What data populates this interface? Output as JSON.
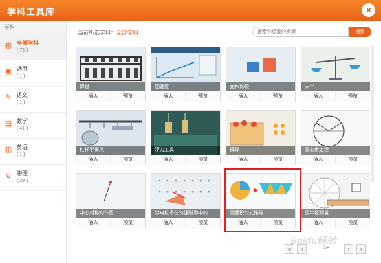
{
  "window": {
    "title": "学科工具库"
  },
  "sidebar": {
    "heading": "学科",
    "items": [
      {
        "label": "全部学科",
        "count": "( 73 )",
        "icon": "grid-icon"
      },
      {
        "label": "通用",
        "count": "( 1 )",
        "icon": "tool-icon"
      },
      {
        "label": "语文",
        "count": "( 1 )",
        "icon": "pen-icon"
      },
      {
        "label": "数学",
        "count": "( 41 )",
        "icon": "calculator-icon"
      },
      {
        "label": "英语",
        "count": "( 1 )",
        "icon": "abc-icon"
      },
      {
        "label": "物理",
        "count": "( 29 )",
        "icon": "magnet-icon"
      }
    ]
  },
  "breadcrumb": {
    "prefix": "当前所选学科：",
    "value": "全部学科"
  },
  "search": {
    "placeholder": "搜索你想要的资源",
    "button": "搜索"
  },
  "card_actions": {
    "insert": "插入",
    "preview": "预览"
  },
  "cards": [
    {
      "title": "算盘"
    },
    {
      "title": "加速度"
    },
    {
      "title": "面积比较"
    },
    {
      "title": "天平"
    },
    {
      "title": "杠杆平衡尺"
    },
    {
      "title": "浮力工具"
    },
    {
      "title": "摸球"
    },
    {
      "title": "圆心角定理"
    },
    {
      "title": "中心对称的作图"
    },
    {
      "title": "带电粒子在匀强磁场中的..."
    },
    {
      "title": "圆面积公式推导"
    },
    {
      "title": "圆半径测量"
    }
  ],
  "pager": {
    "page": "1/4"
  },
  "watermark": "Baidu经验",
  "accent_color": "#e8631a"
}
